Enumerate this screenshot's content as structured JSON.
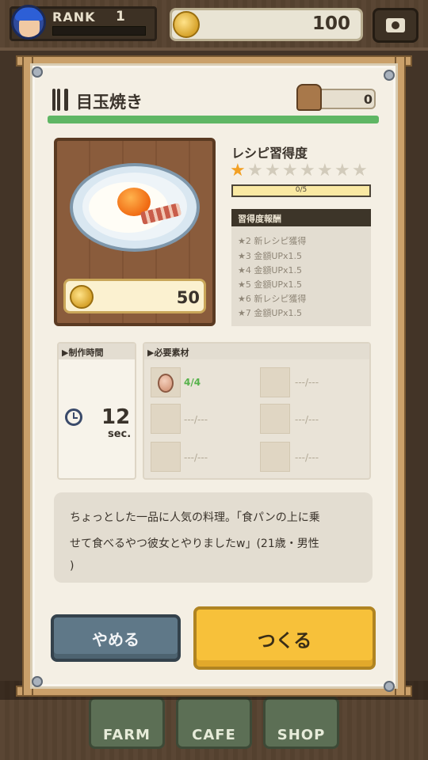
{
  "topbar": {
    "rank_label": "RANK",
    "rank_value": "1",
    "coins": "100"
  },
  "recipe": {
    "title": "目玉焼き",
    "owned_count": "0",
    "price": "50"
  },
  "mastery": {
    "label": "レシピ習得度",
    "stars_total": 8,
    "stars_filled": 1,
    "progress_text": "0/5",
    "progress_fraction": 0.0,
    "reward_header": "習得度報酬",
    "rewards": [
      "★2 新レシピ獲得",
      "★3 金額UPx1.5",
      "★4 金額UPx1.5",
      "★5 金額UPx1.5",
      "★6 新レシピ獲得",
      "★7 金額UPx1.5"
    ]
  },
  "production": {
    "header": "▶制作時間",
    "time_value": "12",
    "time_unit": "sec."
  },
  "materials": {
    "header": "▶必要素材",
    "slots": [
      {
        "icon": "egg-icon",
        "count": "4/4"
      },
      {
        "icon": "empty",
        "count": "---/---"
      },
      {
        "icon": "empty",
        "count": "---/---"
      },
      {
        "icon": "empty",
        "count": "---/---"
      },
      {
        "icon": "empty",
        "count": "---/---"
      },
      {
        "icon": "empty",
        "count": "---/---"
      }
    ]
  },
  "description": {
    "lines": [
      "ちょっとした一品に人気の料理。「食パンの上に乗",
      "せて食べるやつ彼女とやりましたw」(21歳・男性",
      ")"
    ]
  },
  "buttons": {
    "cancel": "やめる",
    "make": "つくる"
  },
  "nav": {
    "farm": "FARM",
    "cafe": "CAFE",
    "shop": "SHOP"
  },
  "colors": {
    "accent_green": "#5fb664",
    "star_on": "#f2a024",
    "make_button": "#f7c13a",
    "cancel_button": "#5f7888"
  }
}
